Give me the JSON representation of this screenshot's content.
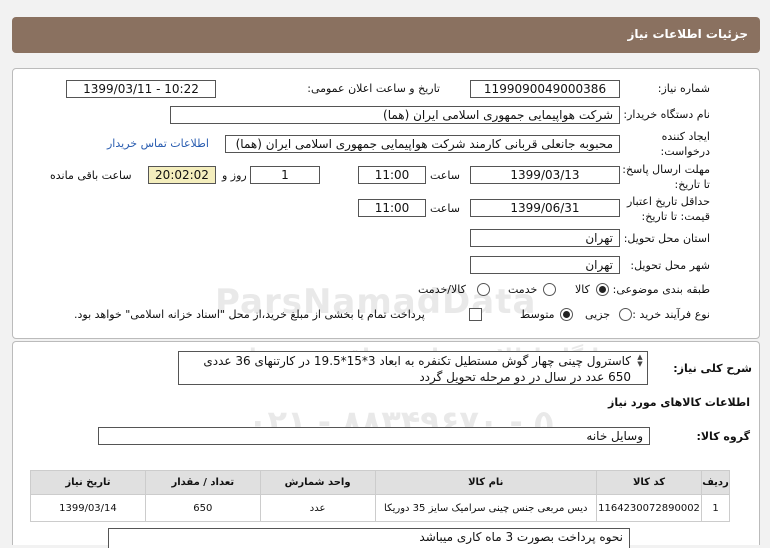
{
  "header": {
    "title": "جزئیات اطلاعات نیاز"
  },
  "watermark": {
    "brand": "ParsNamadData",
    "subtitle": "پایگاه اطلاع رسانی مناقصه و مزایده",
    "phone": "۰۲۱ - ۸۸۳۴۹۶۷۰ - ۵"
  },
  "form": {
    "need_number_label": "شماره نیاز:",
    "need_number": "1199090049000386",
    "announce_label": "تاریخ و ساعت اعلان عمومی:",
    "announce_value": "1399/03/11 - 10:22",
    "buyer_label": "نام دستگاه خریدار:",
    "buyer_value": "شرکت هواپیمایی جمهوری اسلامی ایران (هما)",
    "creator_label_1": "ایجاد کننده",
    "creator_label_2": "درخواست:",
    "creator_value": "محبوبه جانعلی قربانی کارمند شرکت هواپیمایی جمهوری اسلامی ایران (هما)",
    "contact_link": "اطلاعات تماس خریدار",
    "deadline_label_1": "مهلت ارسال پاسخ:",
    "deadline_label_2": "تا تاریخ:",
    "deadline_date": "1399/03/13",
    "time_label": "ساعت",
    "deadline_time": "11:00",
    "days_value": "1",
    "days_label": "روز و",
    "remaining_time": "20:02:02",
    "remaining_label": "ساعت باقی مانده",
    "validity_label_1": "حداقل تاریخ اعتبار",
    "validity_label_2": "قیمت: تا تاریخ:",
    "validity_date": "1399/06/31",
    "validity_time": "11:00",
    "province_label": "استان محل تحویل:",
    "province_value": "تهران",
    "city_label": "شهر محل تحویل:",
    "city_value": "تهران",
    "category_label": "طبقه بندی موضوعی:",
    "category_options": [
      "کالا",
      "خدمت",
      "کالا/خدمت"
    ],
    "category_selected": "کالا",
    "process_label": "نوع فرآیند خرید :",
    "process_options": [
      "جزیی",
      "متوسط"
    ],
    "process_selected": "متوسط",
    "payment_text": "پرداخت تمام یا بخشی از مبلغ خرید،از محل \"اسناد خزانه اسلامی\" خواهد بود."
  },
  "summary": {
    "label": "شرح کلی نیاز:",
    "line1": "کاسترول چینی چهار گوش مستطیل تکنفره  به ابعاد 3*15*19.5  در کارتنهای 36 عددی",
    "line2": "650 عدد در سال در دو مرحله تحویل گردد"
  },
  "goods": {
    "section_title": "اطلاعات کالاهای مورد نیاز",
    "group_label": "گروه کالا:",
    "group_value": "وسایل خانه",
    "columns": [
      "ردیف",
      "کد کالا",
      "نام کالا",
      "واحد شمارش",
      "تعداد / مقدار",
      "تاریخ نیاز"
    ],
    "rows": [
      [
        "1",
        "1164230072890002",
        "دیس مربعی جنس چینی سرامیک سایز 35 دوریکا",
        "عدد",
        "650",
        "1399/03/14"
      ]
    ]
  },
  "notes": {
    "line1": "نحوه پرداخت بصورت 3 ماه کاری میباشد"
  }
}
